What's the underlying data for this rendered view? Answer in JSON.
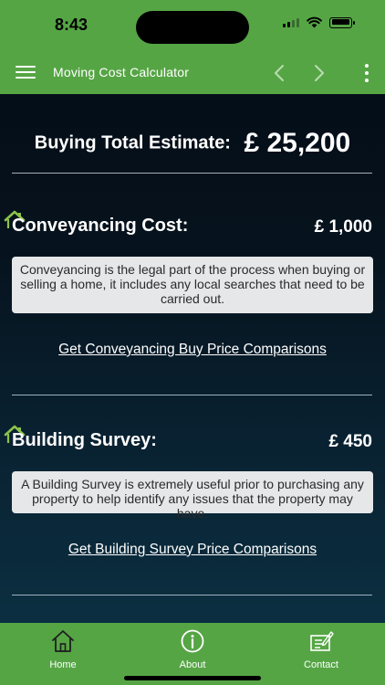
{
  "status": {
    "time": "8:43"
  },
  "appbar": {
    "title": "Moving Cost Calculator"
  },
  "total": {
    "label": "Buying Total Estimate:",
    "value": "£ 25,200"
  },
  "sections": [
    {
      "title": "Conveyancing Cost:",
      "amount": "£ 1,000",
      "description": "Conveyancing is the legal part of the process when buying or selling a home, it includes any local searches that need to be carried out.",
      "link": "Get Conveyancing Buy Price Comparisons"
    },
    {
      "title": "Building Survey:",
      "amount": "£ 450",
      "description": "A Building Survey is extremely useful prior to purchasing any property to help identify any issues that the property may have.",
      "link": "Get Building Survey Price Comparisons"
    }
  ],
  "tabs": [
    {
      "label": "Home",
      "icon": "home-icon"
    },
    {
      "label": "About",
      "icon": "info-icon"
    },
    {
      "label": "Contact",
      "icon": "contact-form-icon"
    }
  ],
  "colors": {
    "brand_green": "#56a545",
    "house_icon_green": "#8bc34a",
    "description_bg": "#e6e7e8"
  }
}
